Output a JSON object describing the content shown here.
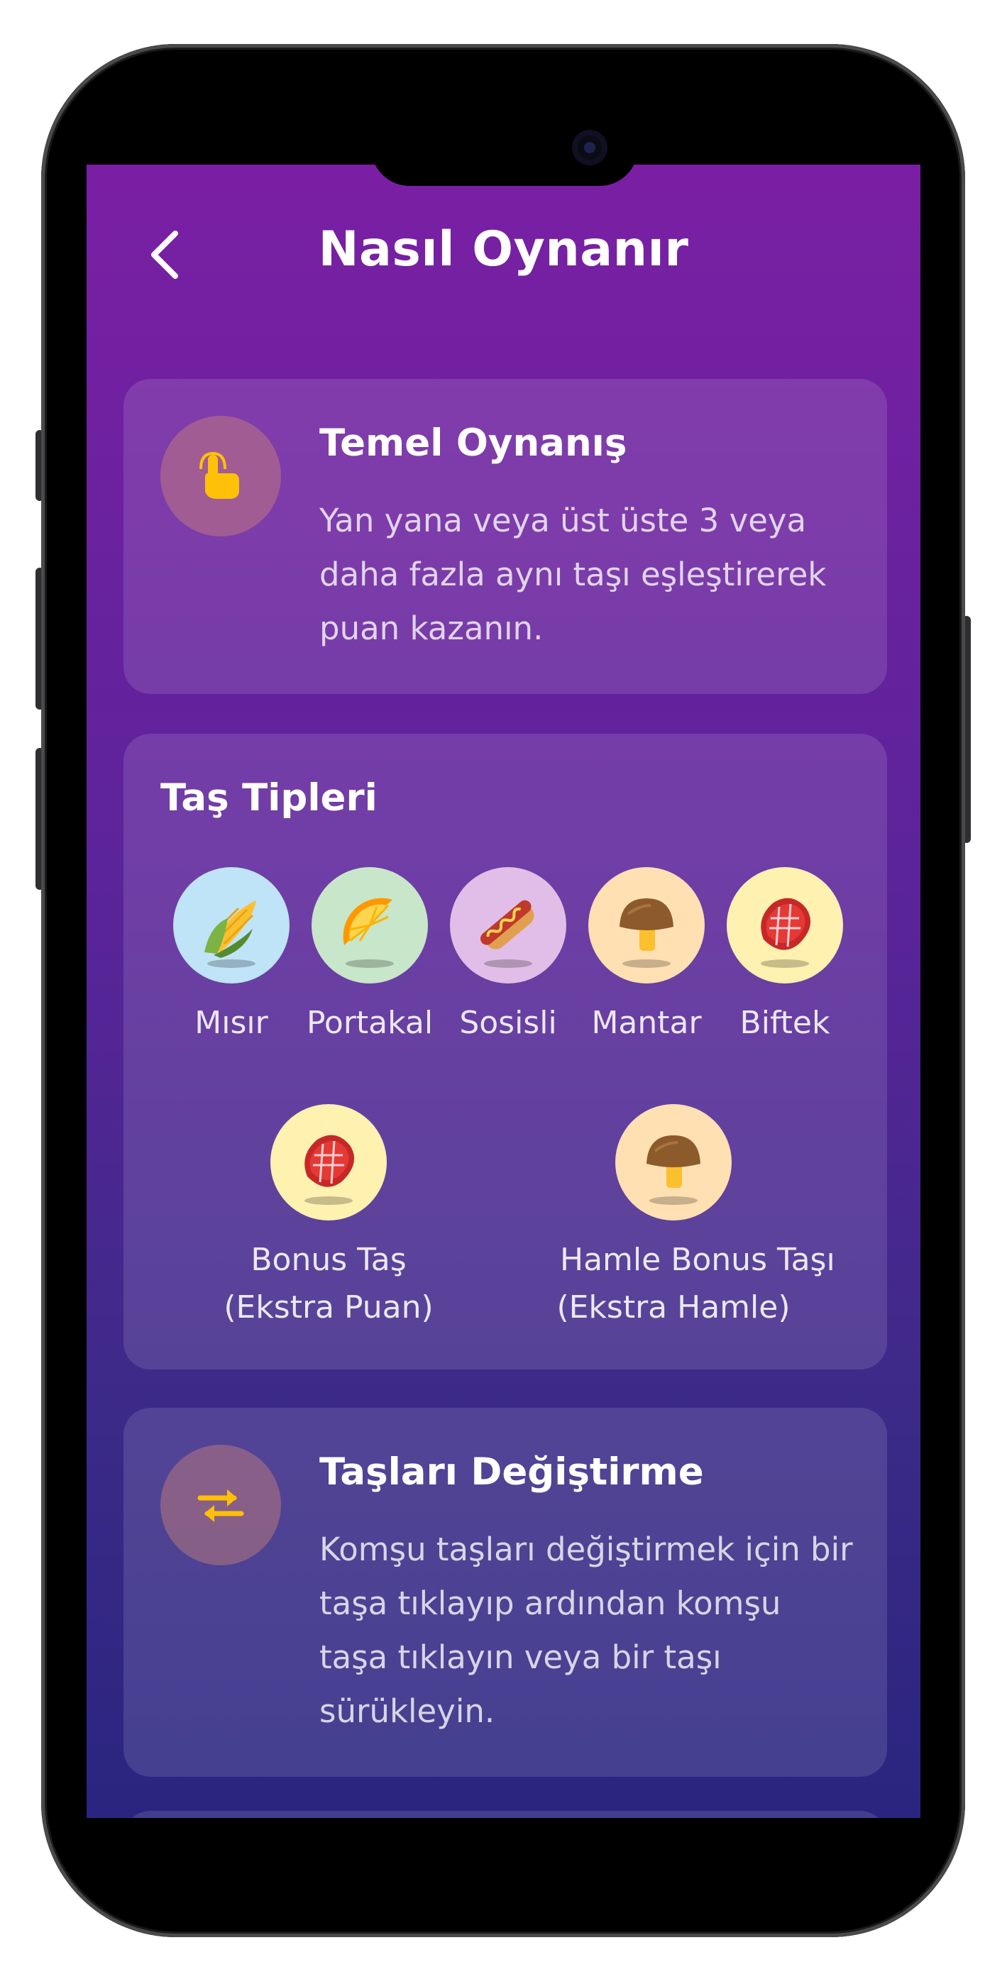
{
  "header": {
    "title": "Nasıl Oynanır",
    "back_icon": "chevron-left-icon"
  },
  "basic_gameplay": {
    "icon": "tap-finger-icon",
    "title": "Temel Oynanış",
    "text": "Yan yana veya üst üste 3 veya daha fazla aynı taşı eşleştirerek puan kazanın."
  },
  "tile_types": {
    "title": "Taş Tipleri",
    "items": [
      {
        "label": "Mısır",
        "icon": "corn-icon",
        "bg": "#bfe3f7"
      },
      {
        "label": "Portakal",
        "icon": "orange-slice-icon",
        "bg": "#c8e6c9"
      },
      {
        "label": "Sosisli",
        "icon": "hotdog-icon",
        "bg": "#e1bee7"
      },
      {
        "label": "Mantar",
        "icon": "mushroom-icon",
        "bg": "#ffe0b2"
      },
      {
        "label": "Biftek",
        "icon": "steak-icon",
        "bg": "#fff1b0"
      }
    ],
    "bonus": [
      {
        "label": "Bonus Taş",
        "sub": "(Ekstra Puan)",
        "icon": "steak-icon",
        "bg": "#fff1b0"
      },
      {
        "label": "Hamle Bonus Taşı",
        "sub": "(Ekstra Hamle)",
        "icon": "mushroom-icon",
        "bg": "#ffe0b2"
      }
    ]
  },
  "swap_tiles": {
    "icon": "swap-arrows-icon",
    "title": "Taşları Değiştirme",
    "text": "Komşu taşları değiştirmek için bir taşa tıklayıp ardından komşu taşa tıklayın veya bir taşı sürükleyin."
  },
  "colors": {
    "accent_icon": "#ffc107",
    "bg_top": "#7a1fa4",
    "bg_bottom": "#2a2580"
  }
}
